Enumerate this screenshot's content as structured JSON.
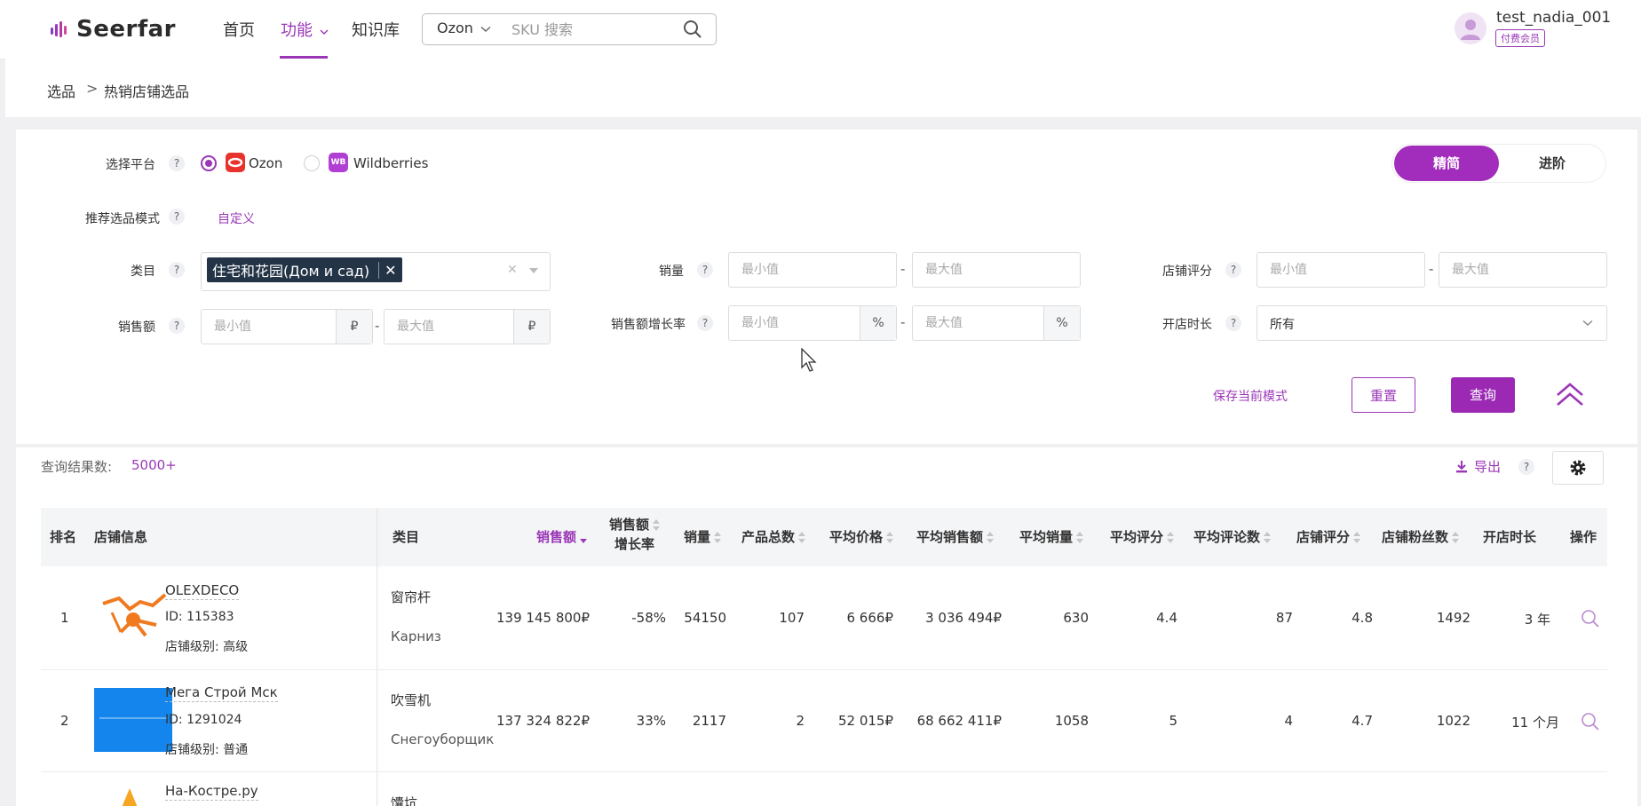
{
  "brand": {
    "name": "Seerfar",
    "accent": "#9b37b7"
  },
  "nav": {
    "items": [
      {
        "label": "首页"
      },
      {
        "label": "功能"
      },
      {
        "label": "知识库"
      }
    ],
    "search": {
      "platform": "Ozon",
      "placeholder": "SKU 搜索"
    }
  },
  "user": {
    "name": "test_nadia_001",
    "badge": "付费会员"
  },
  "breadcrumb": {
    "root": "选品",
    "separator": ">",
    "current": "热销店铺选品"
  },
  "filters": {
    "platform": {
      "label": "选择平台",
      "options": [
        {
          "label": "Ozon",
          "selected": true
        },
        {
          "label": "Wildberries",
          "selected": false,
          "icon_text": "WB"
        }
      ]
    },
    "mode": {
      "label": "推荐选品模式",
      "value": "自定义"
    },
    "view_toggle": {
      "basic": "精简",
      "advanced": "进阶"
    },
    "category": {
      "label": "类目",
      "tag": "住宅和花园(Дом и сад)"
    },
    "sales_volume": {
      "label": "销量",
      "min_placeholder": "最小值",
      "max_placeholder": "最大值"
    },
    "shop_rating": {
      "label": "店铺评分",
      "min_placeholder": "最小值",
      "max_placeholder": "最大值"
    },
    "sales_amount": {
      "label": "销售额",
      "min_placeholder": "最小值",
      "max_placeholder": "最大值",
      "unit": "₽"
    },
    "sales_growth": {
      "label": "销售额增长率",
      "min_placeholder": "最小值",
      "max_placeholder": "最大值",
      "unit": "%"
    },
    "shop_age": {
      "label": "开店时长",
      "value": "所有"
    },
    "dash": "-",
    "help": "?",
    "actions": {
      "save": "保存当前模式",
      "reset": "重置",
      "query": "查询"
    }
  },
  "results": {
    "count_label": "查询结果数:",
    "count_value": "5000+",
    "export": "导出",
    "columns": {
      "rank": "排名",
      "shop": "店铺信息",
      "category": "类目",
      "sales": "销售额",
      "growth_1": "销售额",
      "growth_2": "增长率",
      "volume": "销量",
      "products": "产品总数",
      "avg_price": "平均价格",
      "avg_sales": "平均销售额",
      "avg_volume": "平均销量",
      "avg_rating": "平均评分",
      "avg_reviews": "平均评论数",
      "shop_rating": "店铺评分",
      "followers": "店铺粉丝数",
      "age": "开店时长",
      "action": "操作"
    },
    "rows": [
      {
        "rank": "1",
        "name": "OLEXDECO",
        "id": "ID: 115383",
        "level": "店铺级别: 高级",
        "category_cn": "窗帘杆",
        "category_ru": "Карниз",
        "sales": "139 145 800₽",
        "growth": "-58%",
        "volume": "54150",
        "products": "107",
        "avg_price": "6 666₽",
        "avg_sales": "3 036 494₽",
        "avg_volume": "630",
        "avg_rating": "4.4",
        "avg_reviews": "87",
        "shop_rating": "4.8",
        "followers": "1492",
        "age": "3 年"
      },
      {
        "rank": "2",
        "name": "Мега Строй Мск",
        "id": "ID: 1291024",
        "level": "店铺级别: 普通",
        "category_cn": "吹雪机",
        "category_ru": "Снегоуборщик",
        "sales": "137 324 822₽",
        "growth": "33%",
        "volume": "2117",
        "products": "2",
        "avg_price": "52 015₽",
        "avg_sales": "68 662 411₽",
        "avg_volume": "1058",
        "avg_rating": "5",
        "avg_reviews": "4",
        "shop_rating": "4.7",
        "followers": "1022",
        "age": "11 个月"
      },
      {
        "name": "На-Костре.ру",
        "category_cn": "馕坑"
      }
    ]
  }
}
